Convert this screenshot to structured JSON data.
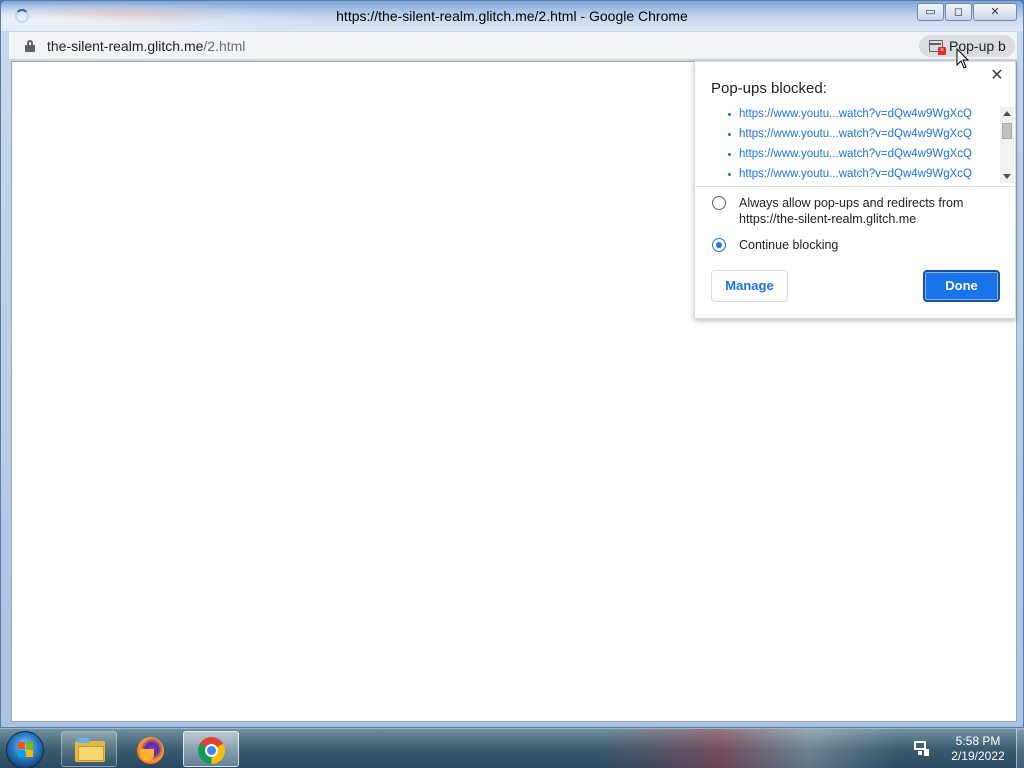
{
  "window": {
    "title": "https://the-silent-realm.glitch.me/2.html - Google Chrome",
    "controls": {
      "minimize": "▭",
      "maximize": "◻",
      "close": "✕"
    }
  },
  "omnibox": {
    "host": "the-silent-realm.glitch.me",
    "path": "/2.html",
    "popup_chip_label": "Pop-up b"
  },
  "popup_bubble": {
    "title": "Pop-ups blocked:",
    "close_glyph": "✕",
    "blocked_links": [
      "https://www.youtu...watch?v=dQw4w9WgXcQ",
      "https://www.youtu...watch?v=dQw4w9WgXcQ",
      "https://www.youtu...watch?v=dQw4w9WgXcQ",
      "https://www.youtu...watch?v=dQw4w9WgXcQ"
    ],
    "option_allow": "Always allow pop-ups and redirects from https://the-silent-realm.glitch.me",
    "option_block": "Continue blocking",
    "selected_option": "block",
    "manage_label": "Manage",
    "done_label": "Done"
  },
  "taskbar": {
    "pinned": [
      {
        "name": "windows-explorer",
        "icon": "folder-icon"
      },
      {
        "name": "firefox",
        "icon": "firefox-icon"
      },
      {
        "name": "google-chrome",
        "icon": "chrome-icon",
        "active": true
      }
    ],
    "time": "5:58 PM",
    "date": "2/19/2022"
  },
  "colors": {
    "link": "#1a73e8",
    "done_button": "#1a73e8",
    "titlebar": "#c6d8ef"
  }
}
